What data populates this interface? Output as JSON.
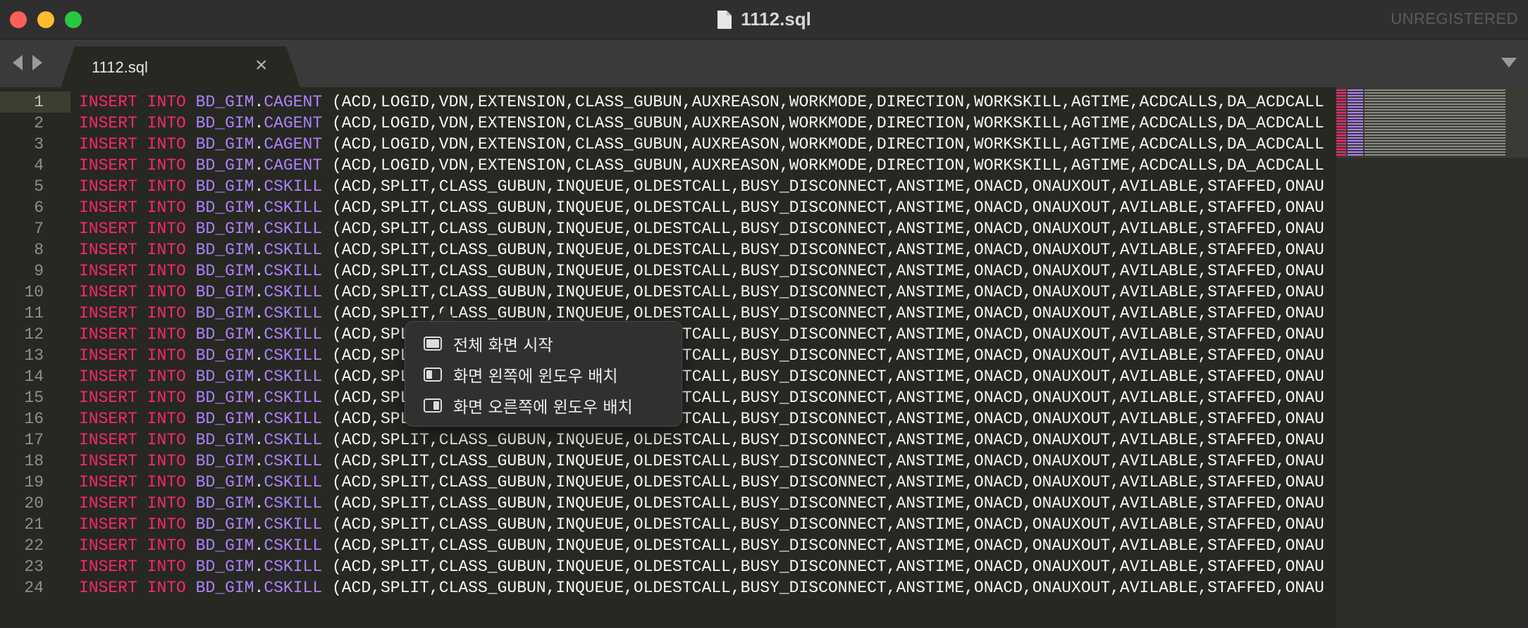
{
  "window": {
    "title": "1112.sql",
    "license_status": "UNREGISTERED"
  },
  "tabs": [
    {
      "label": "1112.sql",
      "close": "×"
    }
  ],
  "icons": {
    "file": "document-icon",
    "tab_close": "close-icon",
    "nav_back": "chevron-left-icon",
    "nav_forward": "chevron-right-icon",
    "tab_menu": "chevron-down-icon"
  },
  "colors": {
    "keyword": "#f92672",
    "identifier": "#ae81ff",
    "text": "#f8f8f2",
    "background": "#272822"
  },
  "editor": {
    "current_line": 1,
    "lines": [
      {
        "num": "1",
        "kw1": "INSERT",
        "kw2": "INTO",
        "schema": "BD_GIM",
        "table": "CAGENT",
        "cols": "(ACD,LOGID,VDN,EXTENSION,CLASS_GUBUN,AUXREASON,WORKMODE,DIRECTION,WORKSKILL,AGTIME,ACDCALLS,DA_ACDCALL"
      },
      {
        "num": "2",
        "kw1": "INSERT",
        "kw2": "INTO",
        "schema": "BD_GIM",
        "table": "CAGENT",
        "cols": "(ACD,LOGID,VDN,EXTENSION,CLASS_GUBUN,AUXREASON,WORKMODE,DIRECTION,WORKSKILL,AGTIME,ACDCALLS,DA_ACDCALL"
      },
      {
        "num": "3",
        "kw1": "INSERT",
        "kw2": "INTO",
        "schema": "BD_GIM",
        "table": "CAGENT",
        "cols": "(ACD,LOGID,VDN,EXTENSION,CLASS_GUBUN,AUXREASON,WORKMODE,DIRECTION,WORKSKILL,AGTIME,ACDCALLS,DA_ACDCALL"
      },
      {
        "num": "4",
        "kw1": "INSERT",
        "kw2": "INTO",
        "schema": "BD_GIM",
        "table": "CAGENT",
        "cols": "(ACD,LOGID,VDN,EXTENSION,CLASS_GUBUN,AUXREASON,WORKMODE,DIRECTION,WORKSKILL,AGTIME,ACDCALLS,DA_ACDCALL"
      },
      {
        "num": "5",
        "kw1": "INSERT",
        "kw2": "INTO",
        "schema": "BD_GIM",
        "table": "CSKILL",
        "cols": "(ACD,SPLIT,CLASS_GUBUN,INQUEUE,OLDESTCALL,BUSY_DISCONNECT,ANSTIME,ONACD,ONAUXOUT,AVILABLE,STAFFED,ONAU"
      },
      {
        "num": "6",
        "kw1": "INSERT",
        "kw2": "INTO",
        "schema": "BD_GIM",
        "table": "CSKILL",
        "cols": "(ACD,SPLIT,CLASS_GUBUN,INQUEUE,OLDESTCALL,BUSY_DISCONNECT,ANSTIME,ONACD,ONAUXOUT,AVILABLE,STAFFED,ONAU"
      },
      {
        "num": "7",
        "kw1": "INSERT",
        "kw2": "INTO",
        "schema": "BD_GIM",
        "table": "CSKILL",
        "cols": "(ACD,SPLIT,CLASS_GUBUN,INQUEUE,OLDESTCALL,BUSY_DISCONNECT,ANSTIME,ONACD,ONAUXOUT,AVILABLE,STAFFED,ONAU"
      },
      {
        "num": "8",
        "kw1": "INSERT",
        "kw2": "INTO",
        "schema": "BD_GIM",
        "table": "CSKILL",
        "cols": "(ACD,SPLIT,CLASS_GUBUN,INQUEUE,OLDESTCALL,BUSY_DISCONNECT,ANSTIME,ONACD,ONAUXOUT,AVILABLE,STAFFED,ONAU"
      },
      {
        "num": "9",
        "kw1": "INSERT",
        "kw2": "INTO",
        "schema": "BD_GIM",
        "table": "CSKILL",
        "cols": "(ACD,SPLIT,CLASS_GUBUN,INQUEUE,OLDESTCALL,BUSY_DISCONNECT,ANSTIME,ONACD,ONAUXOUT,AVILABLE,STAFFED,ONAU"
      },
      {
        "num": "10",
        "kw1": "INSERT",
        "kw2": "INTO",
        "schema": "BD_GIM",
        "table": "CSKILL",
        "cols": "(ACD,SPLIT,CLASS_GUBUN,INQUEUE,OLDESTCALL,BUSY_DISCONNECT,ANSTIME,ONACD,ONAUXOUT,AVILABLE,STAFFED,ONAU"
      },
      {
        "num": "11",
        "kw1": "INSERT",
        "kw2": "INTO",
        "schema": "BD_GIM",
        "table": "CSKILL",
        "cols": "(ACD,SPLIT,CLASS_GUBUN,INQUEUE,OLDESTCALL,BUSY_DISCONNECT,ANSTIME,ONACD,ONAUXOUT,AVILABLE,STAFFED,ONAU"
      },
      {
        "num": "12",
        "kw1": "INSERT",
        "kw2": "INTO",
        "schema": "BD_GIM",
        "table": "CSKILL",
        "cols": "(ACD,SPLIT,CLASS_GUBUN,INQUEUE,OLDESTCALL,BUSY_DISCONNECT,ANSTIME,ONACD,ONAUXOUT,AVILABLE,STAFFED,ONAU"
      },
      {
        "num": "13",
        "kw1": "INSERT",
        "kw2": "INTO",
        "schema": "BD_GIM",
        "table": "CSKILL",
        "cols": "(ACD,SPLIT,CLASS_GUBUN,INQUEUE,OLDESTCALL,BUSY_DISCONNECT,ANSTIME,ONACD,ONAUXOUT,AVILABLE,STAFFED,ONAU"
      },
      {
        "num": "14",
        "kw1": "INSERT",
        "kw2": "INTO",
        "schema": "BD_GIM",
        "table": "CSKILL",
        "cols": "(ACD,SPLIT,CLASS_GUBUN,INQUEUE,OLDESTCALL,BUSY_DISCONNECT,ANSTIME,ONACD,ONAUXOUT,AVILABLE,STAFFED,ONAU"
      },
      {
        "num": "15",
        "kw1": "INSERT",
        "kw2": "INTO",
        "schema": "BD_GIM",
        "table": "CSKILL",
        "cols": "(ACD,SPLIT,CLASS_GUBUN,INQUEUE,OLDESTCALL,BUSY_DISCONNECT,ANSTIME,ONACD,ONAUXOUT,AVILABLE,STAFFED,ONAU"
      },
      {
        "num": "16",
        "kw1": "INSERT",
        "kw2": "INTO",
        "schema": "BD_GIM",
        "table": "CSKILL",
        "cols": "(ACD,SPLIT,CLASS_GUBUN,INQUEUE,OLDESTCALL,BUSY_DISCONNECT,ANSTIME,ONACD,ONAUXOUT,AVILABLE,STAFFED,ONAU"
      },
      {
        "num": "17",
        "kw1": "INSERT",
        "kw2": "INTO",
        "schema": "BD_GIM",
        "table": "CSKILL",
        "cols": "(ACD,SPLIT,CLASS_GUBUN,INQUEUE,OLDESTCALL,BUSY_DISCONNECT,ANSTIME,ONACD,ONAUXOUT,AVILABLE,STAFFED,ONAU"
      },
      {
        "num": "18",
        "kw1": "INSERT",
        "kw2": "INTO",
        "schema": "BD_GIM",
        "table": "CSKILL",
        "cols": "(ACD,SPLIT,CLASS_GUBUN,INQUEUE,OLDESTCALL,BUSY_DISCONNECT,ANSTIME,ONACD,ONAUXOUT,AVILABLE,STAFFED,ONAU"
      },
      {
        "num": "19",
        "kw1": "INSERT",
        "kw2": "INTO",
        "schema": "BD_GIM",
        "table": "CSKILL",
        "cols": "(ACD,SPLIT,CLASS_GUBUN,INQUEUE,OLDESTCALL,BUSY_DISCONNECT,ANSTIME,ONACD,ONAUXOUT,AVILABLE,STAFFED,ONAU"
      },
      {
        "num": "20",
        "kw1": "INSERT",
        "kw2": "INTO",
        "schema": "BD_GIM",
        "table": "CSKILL",
        "cols": "(ACD,SPLIT,CLASS_GUBUN,INQUEUE,OLDESTCALL,BUSY_DISCONNECT,ANSTIME,ONACD,ONAUXOUT,AVILABLE,STAFFED,ONAU"
      },
      {
        "num": "21",
        "kw1": "INSERT",
        "kw2": "INTO",
        "schema": "BD_GIM",
        "table": "CSKILL",
        "cols": "(ACD,SPLIT,CLASS_GUBUN,INQUEUE,OLDESTCALL,BUSY_DISCONNECT,ANSTIME,ONACD,ONAUXOUT,AVILABLE,STAFFED,ONAU"
      },
      {
        "num": "22",
        "kw1": "INSERT",
        "kw2": "INTO",
        "schema": "BD_GIM",
        "table": "CSKILL",
        "cols": "(ACD,SPLIT,CLASS_GUBUN,INQUEUE,OLDESTCALL,BUSY_DISCONNECT,ANSTIME,ONACD,ONAUXOUT,AVILABLE,STAFFED,ONAU"
      },
      {
        "num": "23",
        "kw1": "INSERT",
        "kw2": "INTO",
        "schema": "BD_GIM",
        "table": "CSKILL",
        "cols": "(ACD,SPLIT,CLASS_GUBUN,INQUEUE,OLDESTCALL,BUSY_DISCONNECT,ANSTIME,ONACD,ONAUXOUT,AVILABLE,STAFFED,ONAU"
      },
      {
        "num": "24",
        "kw1": "INSERT",
        "kw2": "INTO",
        "schema": "BD_GIM",
        "table": "CSKILL",
        "cols": "(ACD,SPLIT,CLASS_GUBUN,INQUEUE,OLDESTCALL,BUSY_DISCONNECT,ANSTIME,ONACD,ONAUXOUT,AVILABLE,STAFFED,ONAU"
      }
    ]
  },
  "window_menu": {
    "items": [
      {
        "label": "전체 화면 시작",
        "icon": "fullscreen-icon"
      },
      {
        "label": "화면 왼쪽에 윈도우 배치",
        "icon": "tile-left-icon"
      },
      {
        "label": "화면 오른쪽에 윈도우 배치",
        "icon": "tile-right-icon"
      }
    ]
  }
}
